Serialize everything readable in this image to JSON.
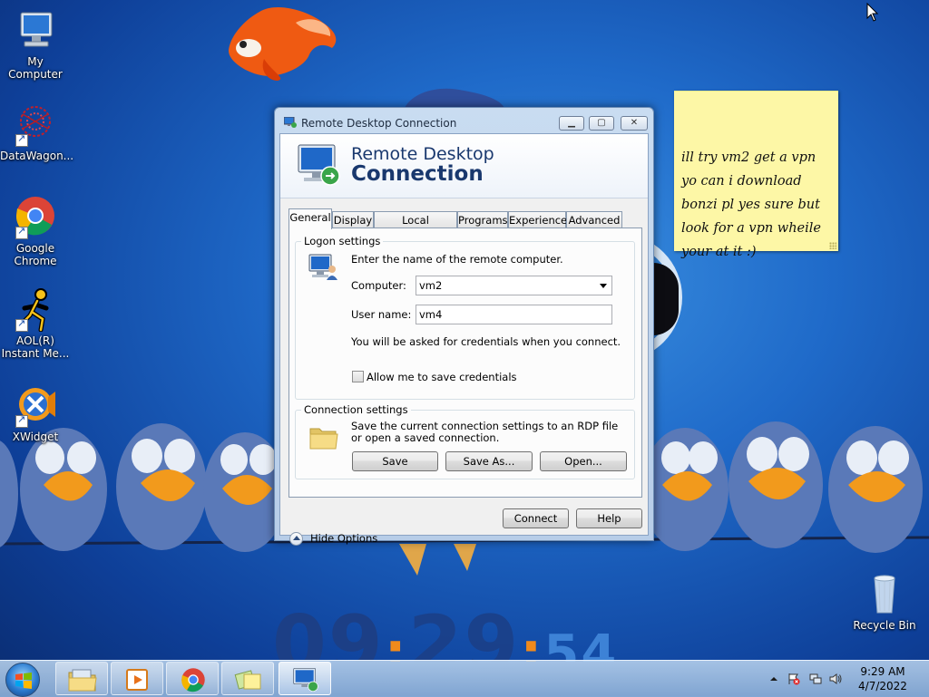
{
  "desktop": {
    "icons": [
      {
        "label": "My Computer"
      },
      {
        "label": "DataWagon..."
      },
      {
        "label": "Google\nChrome"
      },
      {
        "label": "AOL(R)\nInstant Me..."
      },
      {
        "label": "XWidget"
      },
      {
        "label": "Recycle Bin"
      }
    ],
    "wallpaper_clock": {
      "hours": "09",
      "minutes": "29",
      "seconds": "54"
    },
    "sticky_note": {
      "text": "ill try vm2 get a vpn\nyo can i download\nbonzi pl yes  sure but\nlook for a vpn wheile\nyour at it :)"
    }
  },
  "window": {
    "title": "Remote Desktop Connection",
    "banner_line1": "Remote Desktop",
    "banner_line2": "Connection",
    "tabs": [
      "General",
      "Display",
      "Local Resources",
      "Programs",
      "Experience",
      "Advanced"
    ],
    "active_tab": "General",
    "logon": {
      "legend": "Logon settings",
      "instruction": "Enter the name of the remote computer.",
      "computer_label": "Computer:",
      "computer_value": "vm2",
      "username_label": "User name:",
      "username_value": "vm4",
      "credentials_note": "You will be asked for credentials when you connect.",
      "save_credentials_label": "Allow me to save credentials",
      "save_credentials_checked": false
    },
    "connection": {
      "legend": "Connection settings",
      "description": "Save the current connection settings to an RDP file or open a saved connection.",
      "save": "Save",
      "save_as": "Save As...",
      "open": "Open..."
    },
    "hide_options": "Hide Options",
    "connect": "Connect",
    "help": "Help"
  },
  "taskbar": {
    "time": "9:29 AM",
    "date": "4/7/2022",
    "buttons": [
      "windows-explorer",
      "media-player",
      "google-chrome",
      "sticky-notes",
      "remote-desktop-connection"
    ],
    "active": "remote-desktop-connection"
  },
  "colors": {
    "banner_text": "#19386e",
    "desktop_blue": "#1f6ac9",
    "sticky_yellow": "#fdf7a6",
    "clock_orange": "#f08a1c"
  }
}
